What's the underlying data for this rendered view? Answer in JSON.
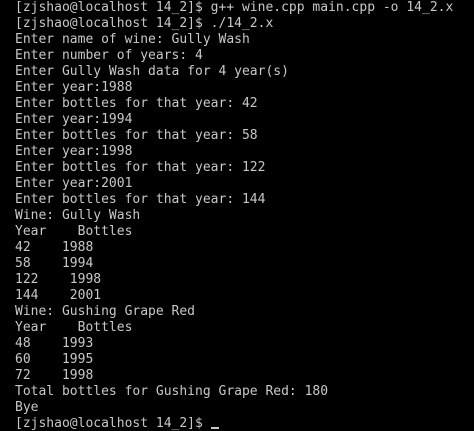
{
  "terminal": {
    "lines": [
      "[zjshao@localhost 14_2]$ g++ wine.cpp main.cpp -o 14_2.x",
      "[zjshao@localhost 14_2]$ ./14_2.x",
      "Enter name of wine: Gully Wash",
      "Enter number of years: 4",
      "Enter Gully Wash data for 4 year(s)",
      "Enter year:1988",
      "Enter bottles for that year: 42",
      "Enter year:1994",
      "Enter bottles for that year: 58",
      "Enter year:1998",
      "Enter bottles for that year: 122",
      "Enter year:2001",
      "Enter bottles for that year: 144",
      "Wine: Gully Wash",
      "Year    Bottles",
      "42    1988",
      "58    1994",
      "122    1998",
      "144    2001",
      "Wine: Gushing Grape Red",
      "Year    Bottles",
      "48    1993",
      "60    1995",
      "72    1998",
      "Total bottles for Gushing Grape Red: 180",
      "Bye"
    ],
    "prompt": "[zjshao@localhost 14_2]$"
  },
  "colors": {
    "background": "#000000",
    "foreground": "#c8c8c8"
  }
}
